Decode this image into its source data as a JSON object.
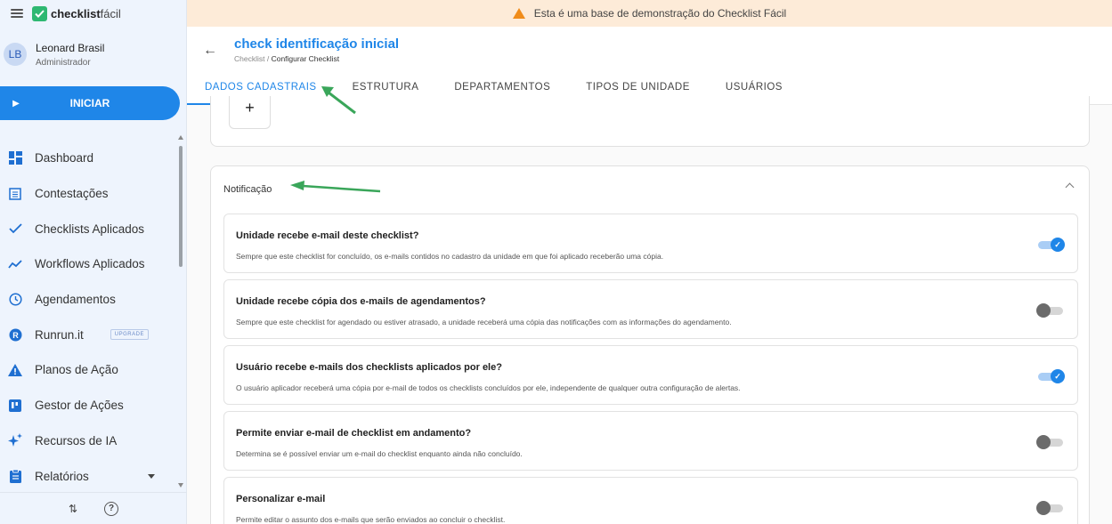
{
  "app": {
    "logo_bold": "checklist",
    "logo_light": "fácil"
  },
  "user": {
    "initials": "LB",
    "name": "Leonard Brasil",
    "role": "Administrador"
  },
  "start_button": "INICIAR",
  "nav": [
    {
      "label": "Dashboard",
      "icon": "dashboard-icon"
    },
    {
      "label": "Contestações",
      "icon": "list-icon"
    },
    {
      "label": "Checklists Aplicados",
      "icon": "check-icon"
    },
    {
      "label": "Workflows Aplicados",
      "icon": "trend-icon"
    },
    {
      "label": "Agendamentos",
      "icon": "clock-icon"
    },
    {
      "label": "Runrun.it",
      "icon": "runrun-icon",
      "badge": "UPGRADE"
    },
    {
      "label": "Planos de Ação",
      "icon": "warning-icon"
    },
    {
      "label": "Gestor de Ações",
      "icon": "board-icon"
    },
    {
      "label": "Recursos de IA",
      "icon": "sparkle-icon"
    },
    {
      "label": "Relatórios",
      "icon": "report-icon"
    }
  ],
  "banner": "Esta é uma base de demonstração do Checklist Fácil",
  "header": {
    "title": "check identificação inicial",
    "crumb_root": "Checklist /",
    "crumb_current": "Configurar Checklist"
  },
  "tabs": [
    "DADOS CADASTRAIS",
    "ESTRUTURA",
    "DEPARTAMENTOS",
    "TIPOS DE UNIDADE",
    "USUÁRIOS"
  ],
  "plus_label": "+",
  "notification": {
    "title": "Notificação",
    "options": [
      {
        "title": "Unidade recebe e-mail deste checklist?",
        "desc": "Sempre que este checklist for concluído, os e-mails contidos no cadastro da unidade em que foi aplicado receberão uma cópia.",
        "enabled": true
      },
      {
        "title": "Unidade recebe cópia dos e-mails de agendamentos?",
        "desc": "Sempre que este checklist for agendado ou estiver atrasado, a unidade receberá uma cópia das notificações com as informações do agendamento.",
        "enabled": false
      },
      {
        "title": "Usuário recebe e-mails dos checklists aplicados por ele?",
        "desc": "O usuário aplicador receberá uma cópia por e-mail de todos os checklists concluídos por ele, independente de qualquer outra configuração de alertas.",
        "enabled": true
      },
      {
        "title": "Permite enviar e-mail de checklist em andamento?",
        "desc": "Determina se é possível enviar um e-mail do checklist enquanto ainda não concluído.",
        "enabled": false
      },
      {
        "title": "Personalizar e-mail",
        "desc": "Permite editar o assunto dos e-mails que serão enviados ao concluir o checklist.",
        "enabled": false
      }
    ]
  },
  "colors": {
    "accent": "#1f86e8",
    "arrow": "#3aa65a",
    "banner": "#fdebd8"
  }
}
